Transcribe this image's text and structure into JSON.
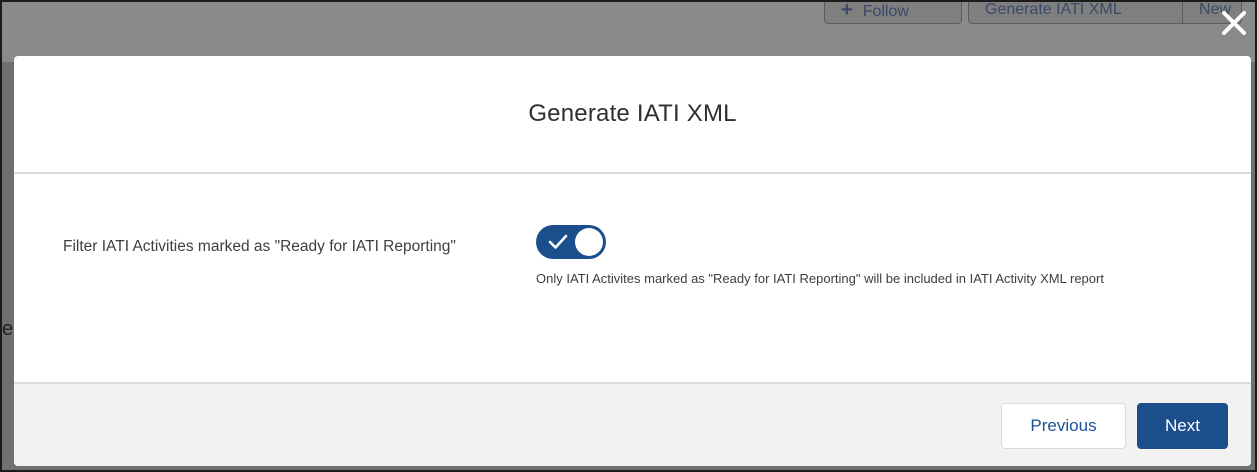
{
  "background": {
    "buttons": {
      "follow_label": "Follow",
      "generate_label": "Generate IATI XML",
      "new_label": "New"
    },
    "partial_letter": "e"
  },
  "modal": {
    "title": "Generate IATI XML",
    "filter": {
      "label": "Filter IATI Activities marked as \"Ready for IATI Reporting\"",
      "toggle_state": "on",
      "help_text": "Only IATI Activites marked as \"Ready for IATI Reporting\" will be included in IATI Activity XML report"
    },
    "footer": {
      "previous_label": "Previous",
      "next_label": "Next"
    }
  },
  "colors": {
    "brand": "#1b4f8c",
    "link": "#1b5297",
    "overlay": "#6b6b6b",
    "footer_bg": "#f3f2f2"
  },
  "icons": {
    "close": "close-icon",
    "check": "check-icon",
    "plus": "plus-icon"
  }
}
